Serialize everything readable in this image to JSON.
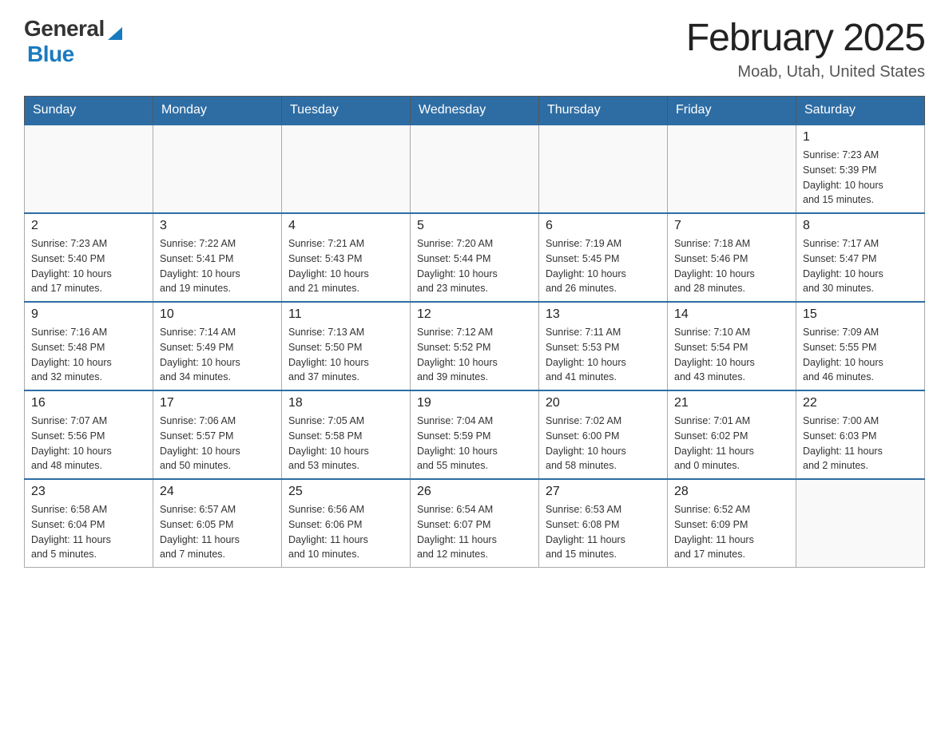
{
  "logo": {
    "text_general": "General",
    "logo_triangle": "▶",
    "text_blue": "Blue"
  },
  "header": {
    "title": "February 2025",
    "subtitle": "Moab, Utah, United States"
  },
  "weekdays": [
    "Sunday",
    "Monday",
    "Tuesday",
    "Wednesday",
    "Thursday",
    "Friday",
    "Saturday"
  ],
  "weeks": [
    [
      {
        "day": "",
        "info": ""
      },
      {
        "day": "",
        "info": ""
      },
      {
        "day": "",
        "info": ""
      },
      {
        "day": "",
        "info": ""
      },
      {
        "day": "",
        "info": ""
      },
      {
        "day": "",
        "info": ""
      },
      {
        "day": "1",
        "info": "Sunrise: 7:23 AM\nSunset: 5:39 PM\nDaylight: 10 hours\nand 15 minutes."
      }
    ],
    [
      {
        "day": "2",
        "info": "Sunrise: 7:23 AM\nSunset: 5:40 PM\nDaylight: 10 hours\nand 17 minutes."
      },
      {
        "day": "3",
        "info": "Sunrise: 7:22 AM\nSunset: 5:41 PM\nDaylight: 10 hours\nand 19 minutes."
      },
      {
        "day": "4",
        "info": "Sunrise: 7:21 AM\nSunset: 5:43 PM\nDaylight: 10 hours\nand 21 minutes."
      },
      {
        "day": "5",
        "info": "Sunrise: 7:20 AM\nSunset: 5:44 PM\nDaylight: 10 hours\nand 23 minutes."
      },
      {
        "day": "6",
        "info": "Sunrise: 7:19 AM\nSunset: 5:45 PM\nDaylight: 10 hours\nand 26 minutes."
      },
      {
        "day": "7",
        "info": "Sunrise: 7:18 AM\nSunset: 5:46 PM\nDaylight: 10 hours\nand 28 minutes."
      },
      {
        "day": "8",
        "info": "Sunrise: 7:17 AM\nSunset: 5:47 PM\nDaylight: 10 hours\nand 30 minutes."
      }
    ],
    [
      {
        "day": "9",
        "info": "Sunrise: 7:16 AM\nSunset: 5:48 PM\nDaylight: 10 hours\nand 32 minutes."
      },
      {
        "day": "10",
        "info": "Sunrise: 7:14 AM\nSunset: 5:49 PM\nDaylight: 10 hours\nand 34 minutes."
      },
      {
        "day": "11",
        "info": "Sunrise: 7:13 AM\nSunset: 5:50 PM\nDaylight: 10 hours\nand 37 minutes."
      },
      {
        "day": "12",
        "info": "Sunrise: 7:12 AM\nSunset: 5:52 PM\nDaylight: 10 hours\nand 39 minutes."
      },
      {
        "day": "13",
        "info": "Sunrise: 7:11 AM\nSunset: 5:53 PM\nDaylight: 10 hours\nand 41 minutes."
      },
      {
        "day": "14",
        "info": "Sunrise: 7:10 AM\nSunset: 5:54 PM\nDaylight: 10 hours\nand 43 minutes."
      },
      {
        "day": "15",
        "info": "Sunrise: 7:09 AM\nSunset: 5:55 PM\nDaylight: 10 hours\nand 46 minutes."
      }
    ],
    [
      {
        "day": "16",
        "info": "Sunrise: 7:07 AM\nSunset: 5:56 PM\nDaylight: 10 hours\nand 48 minutes."
      },
      {
        "day": "17",
        "info": "Sunrise: 7:06 AM\nSunset: 5:57 PM\nDaylight: 10 hours\nand 50 minutes."
      },
      {
        "day": "18",
        "info": "Sunrise: 7:05 AM\nSunset: 5:58 PM\nDaylight: 10 hours\nand 53 minutes."
      },
      {
        "day": "19",
        "info": "Sunrise: 7:04 AM\nSunset: 5:59 PM\nDaylight: 10 hours\nand 55 minutes."
      },
      {
        "day": "20",
        "info": "Sunrise: 7:02 AM\nSunset: 6:00 PM\nDaylight: 10 hours\nand 58 minutes."
      },
      {
        "day": "21",
        "info": "Sunrise: 7:01 AM\nSunset: 6:02 PM\nDaylight: 11 hours\nand 0 minutes."
      },
      {
        "day": "22",
        "info": "Sunrise: 7:00 AM\nSunset: 6:03 PM\nDaylight: 11 hours\nand 2 minutes."
      }
    ],
    [
      {
        "day": "23",
        "info": "Sunrise: 6:58 AM\nSunset: 6:04 PM\nDaylight: 11 hours\nand 5 minutes."
      },
      {
        "day": "24",
        "info": "Sunrise: 6:57 AM\nSunset: 6:05 PM\nDaylight: 11 hours\nand 7 minutes."
      },
      {
        "day": "25",
        "info": "Sunrise: 6:56 AM\nSunset: 6:06 PM\nDaylight: 11 hours\nand 10 minutes."
      },
      {
        "day": "26",
        "info": "Sunrise: 6:54 AM\nSunset: 6:07 PM\nDaylight: 11 hours\nand 12 minutes."
      },
      {
        "day": "27",
        "info": "Sunrise: 6:53 AM\nSunset: 6:08 PM\nDaylight: 11 hours\nand 15 minutes."
      },
      {
        "day": "28",
        "info": "Sunrise: 6:52 AM\nSunset: 6:09 PM\nDaylight: 11 hours\nand 17 minutes."
      },
      {
        "day": "",
        "info": ""
      }
    ]
  ]
}
